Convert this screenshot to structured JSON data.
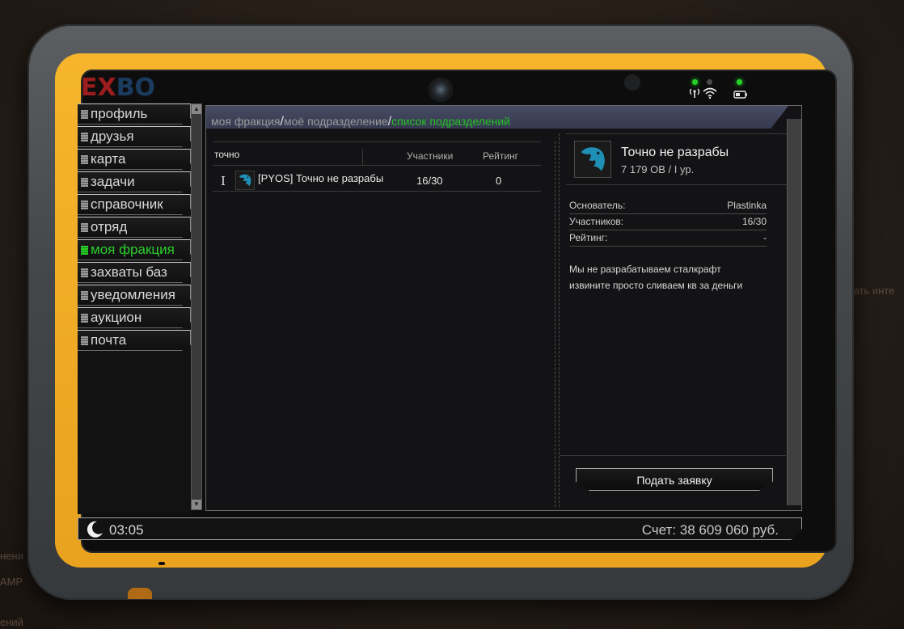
{
  "background": {
    "side_text_right": "дать инте",
    "side_text_left_1": "нени",
    "side_text_left_2": "AMP",
    "side_text_left_3": "ений"
  },
  "logo": {
    "part1": "EX",
    "part2": "BO"
  },
  "status_icons": {
    "signal": "wifi-icon",
    "battery": "battery-icon",
    "antenna": "antenna-icon"
  },
  "nav": {
    "items": [
      {
        "label": "профиль",
        "active": false
      },
      {
        "label": "друзья",
        "active": false
      },
      {
        "label": "карта",
        "active": false
      },
      {
        "label": "задачи",
        "active": false
      },
      {
        "label": "справочник",
        "active": false
      },
      {
        "label": "отряд",
        "active": false
      },
      {
        "label": "моя фракция",
        "active": true
      },
      {
        "label": "захваты баз",
        "active": false
      },
      {
        "label": "уведомления",
        "active": false
      },
      {
        "label": "аукцион",
        "active": false
      },
      {
        "label": "почта",
        "active": false
      }
    ]
  },
  "breadcrumb": {
    "item1": "моя фракция",
    "sep": "/",
    "item2": "моё подразделение",
    "item3": "список подразделений"
  },
  "list": {
    "filter_value": "точно",
    "col_members": "Участники",
    "col_rating": "Рейтинг",
    "rows": [
      {
        "rank": "I",
        "name": "[PYOS] Точно не разрабы",
        "members": "16/30",
        "rating": "0"
      }
    ]
  },
  "detail": {
    "name": "Точно не разрабы",
    "subtitle": "7 179 OB / I ур.",
    "founder_label": "Основатель:",
    "founder_value": "Plastinka",
    "members_label": "Участников:",
    "members_value": "16/30",
    "rating_label": "Рейтинг:",
    "rating_value": "-",
    "description_line1": "Мы не разрабатываем сталкрафт",
    "description_line2": "извините просто сливаем кв за деньги",
    "apply_label": "Подать заявку"
  },
  "statusbar": {
    "time": "03:05",
    "balance": "Счет: 38 609 060 руб."
  },
  "colors": {
    "accent_green": "#23c223",
    "frame_orange": "#f0ad26"
  }
}
